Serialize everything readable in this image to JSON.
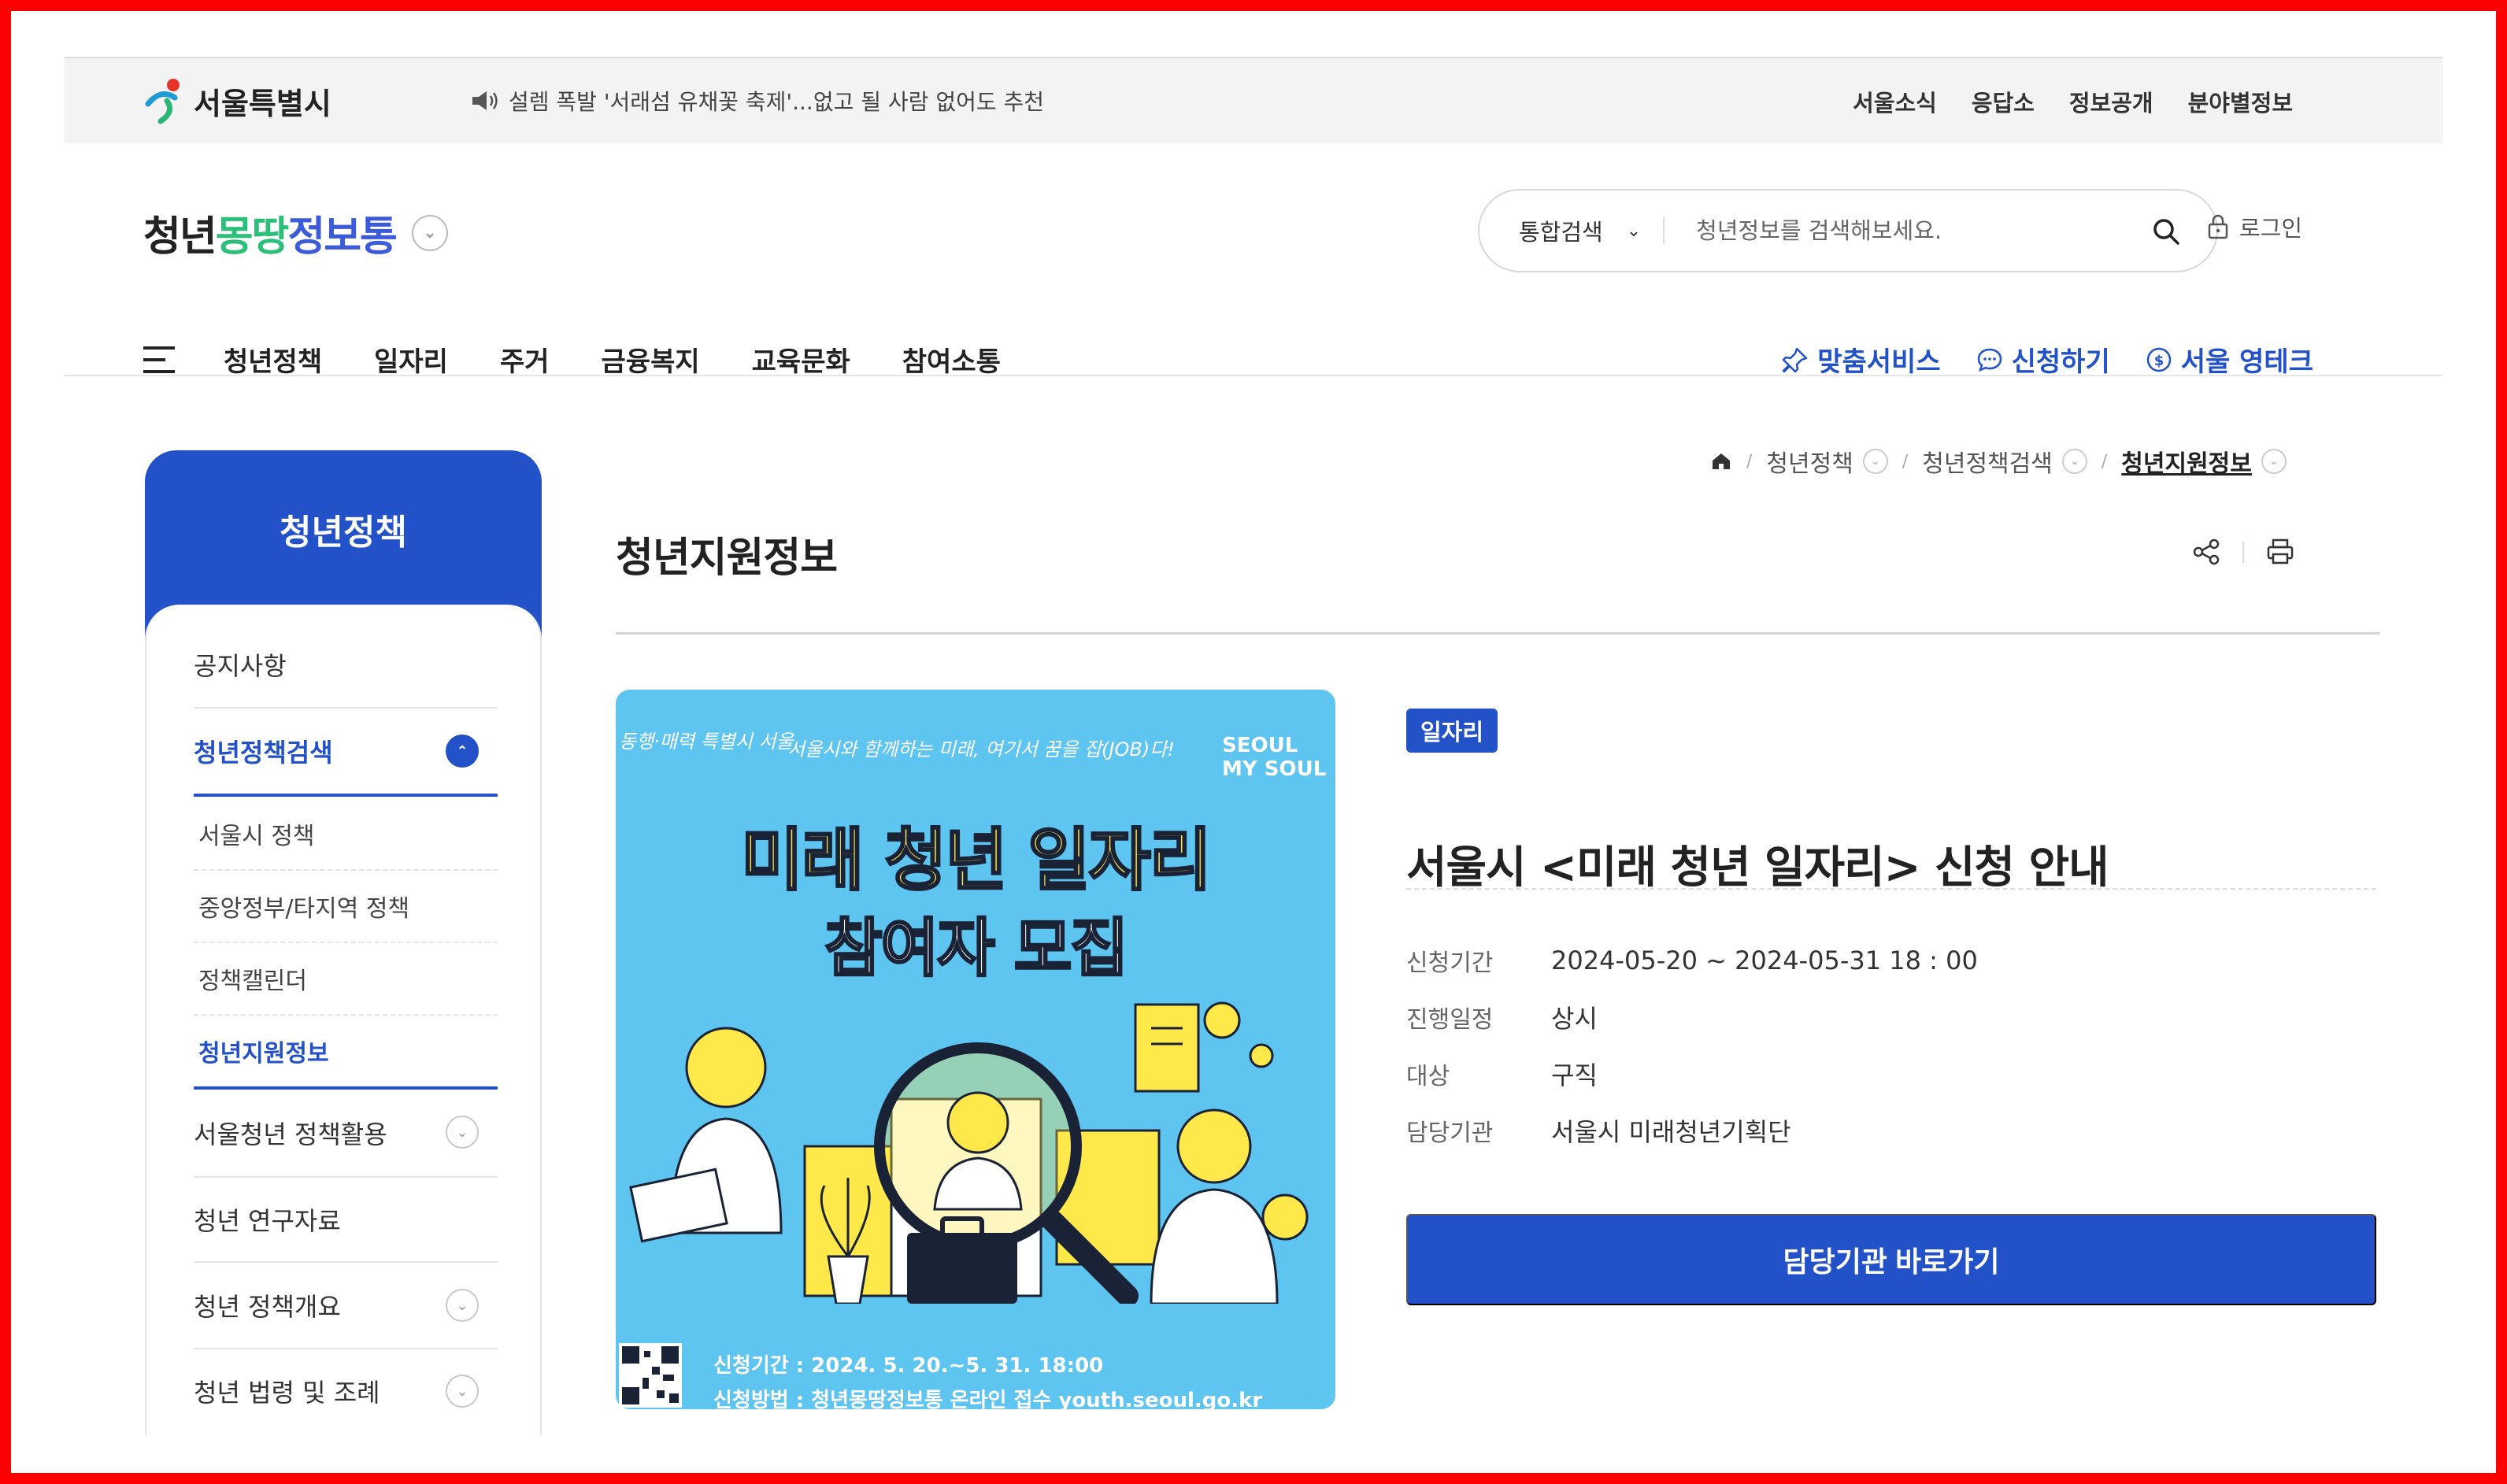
{
  "topbar": {
    "brand": "서울특별시",
    "notice": "설렘 폭발 '서래섬 유채꽃 축제'...없고 될 사람 없어도 추천",
    "util_nav": [
      "서울소식",
      "응답소",
      "정보공개",
      "분야별정보"
    ]
  },
  "header": {
    "logo_parts": [
      "청년",
      "몽땅",
      "정보통"
    ],
    "search": {
      "scope": "통합검색",
      "placeholder": "청년정보를 검색해보세요."
    },
    "login": "로그인",
    "gnb": [
      "청년정책",
      "일자리",
      "주거",
      "금융복지",
      "교육문화",
      "참여소통"
    ],
    "quick": [
      "맞춤서비스",
      "신청하기",
      "서울 영테크"
    ]
  },
  "sidebar": {
    "title": "청년정책",
    "items": [
      {
        "label": "공지사항"
      },
      {
        "label": "청년정책검색"
      },
      {
        "label": "서울시 정책"
      },
      {
        "label": "중앙정부/타지역 정책"
      },
      {
        "label": "정책캘린더"
      },
      {
        "label": "청년지원정보"
      },
      {
        "label": "서울청년 정책활용"
      },
      {
        "label": "청년 연구자료"
      },
      {
        "label": "청년 정책개요"
      },
      {
        "label": "청년 법령 및 조례"
      }
    ]
  },
  "breadcrumb": [
    "청년정책",
    "청년정책검색",
    "청년지원정보"
  ],
  "page_title": "청년지원정보",
  "poster": {
    "top_left": "동행·매력 특별시 서울",
    "top_center": "서울시와 함께하는 미래, 여기서 꿈을 잡(JOB)다!",
    "top_right": "SEOUL MY SOUL",
    "headline1": "미래 청년 일자리",
    "headline2": "참여자 모집",
    "footer1": "신청기간 : 2024. 5. 20.~5. 31. 18:00",
    "footer2": "신청방법 : 청년몽땅정보통 온라인 접수 youth.seoul.go.kr"
  },
  "detail": {
    "category": "일자리",
    "title": "서울시 <미래 청년 일자리> 신청 안내",
    "rows": [
      {
        "label": "신청기간",
        "value": "2024-05-20 ~ 2024-05-31 18 : 00"
      },
      {
        "label": "진행일정",
        "value": "상시"
      },
      {
        "label": "대상",
        "value": "구직"
      },
      {
        "label": "담당기관",
        "value": "서울시 미래청년기획단"
      }
    ],
    "cta": "담당기관 바로가기"
  },
  "colors": {
    "accent": "#2251c8",
    "poster_bg": "#5ec4f0",
    "poster_yellow": "#ffe94a"
  }
}
